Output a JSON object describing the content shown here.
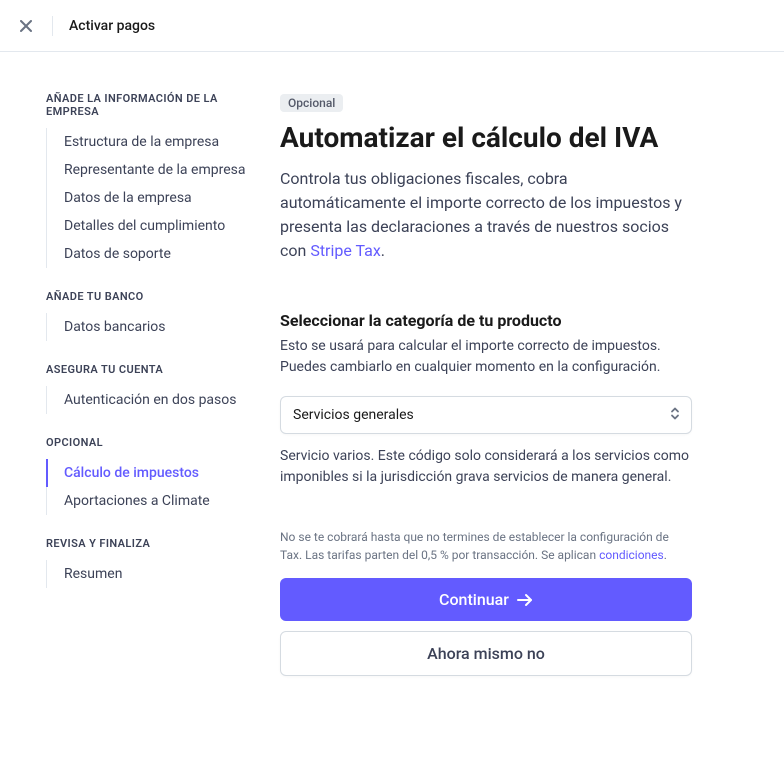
{
  "topbar": {
    "title": "Activar pagos"
  },
  "sidebar": {
    "sections": [
      {
        "title": "AÑADE LA INFORMACIÓN DE LA EMPRESA",
        "items": [
          {
            "label": "Estructura de la empresa",
            "active": false
          },
          {
            "label": "Representante de la empresa",
            "active": false
          },
          {
            "label": "Datos de la empresa",
            "active": false
          },
          {
            "label": "Detalles del cumplimiento",
            "active": false
          },
          {
            "label": "Datos de soporte",
            "active": false
          }
        ]
      },
      {
        "title": "AÑADE TU BANCO",
        "items": [
          {
            "label": "Datos bancarios",
            "active": false
          }
        ]
      },
      {
        "title": "ASEGURA TU CUENTA",
        "items": [
          {
            "label": "Autenticación en dos pasos",
            "active": false
          }
        ]
      },
      {
        "title": "OPCIONAL",
        "items": [
          {
            "label": "Cálculo de impuestos",
            "active": true
          },
          {
            "label": "Aportaciones a Climate",
            "active": false
          }
        ]
      },
      {
        "title": "REVISA Y FINALIZA",
        "items": [
          {
            "label": "Resumen",
            "active": false
          }
        ]
      }
    ]
  },
  "main": {
    "badge": "Opcional",
    "title": "Automatizar el cálculo del IVA",
    "desc_prefix": "Controla tus obligaciones fiscales, cobra automáticamente el importe correcto de los impuestos y presenta las declaraciones a través de nuestros socios con ",
    "desc_link": "Stripe Tax",
    "desc_suffix": ".",
    "section_heading": "Seleccionar la categoría de tu producto",
    "section_sub": "Esto se usará para calcular el importe correcto de impuestos. Puedes cambiarlo en cualquier momento en la configuración.",
    "select_value": "Servicios generales",
    "select_help": "Servicio varios. Este código solo considerará a los servicios como imponibles si la jurisdicción grava servicios de manera general.",
    "footnote_prefix": "No se te cobrará hasta que no termines de establecer la configuración de Tax. Las tarifas parten del 0,5 % por transacción. Se aplican ",
    "footnote_link": "condiciones",
    "footnote_suffix": ".",
    "continue_label": "Continuar",
    "skip_label": "Ahora mismo no"
  }
}
